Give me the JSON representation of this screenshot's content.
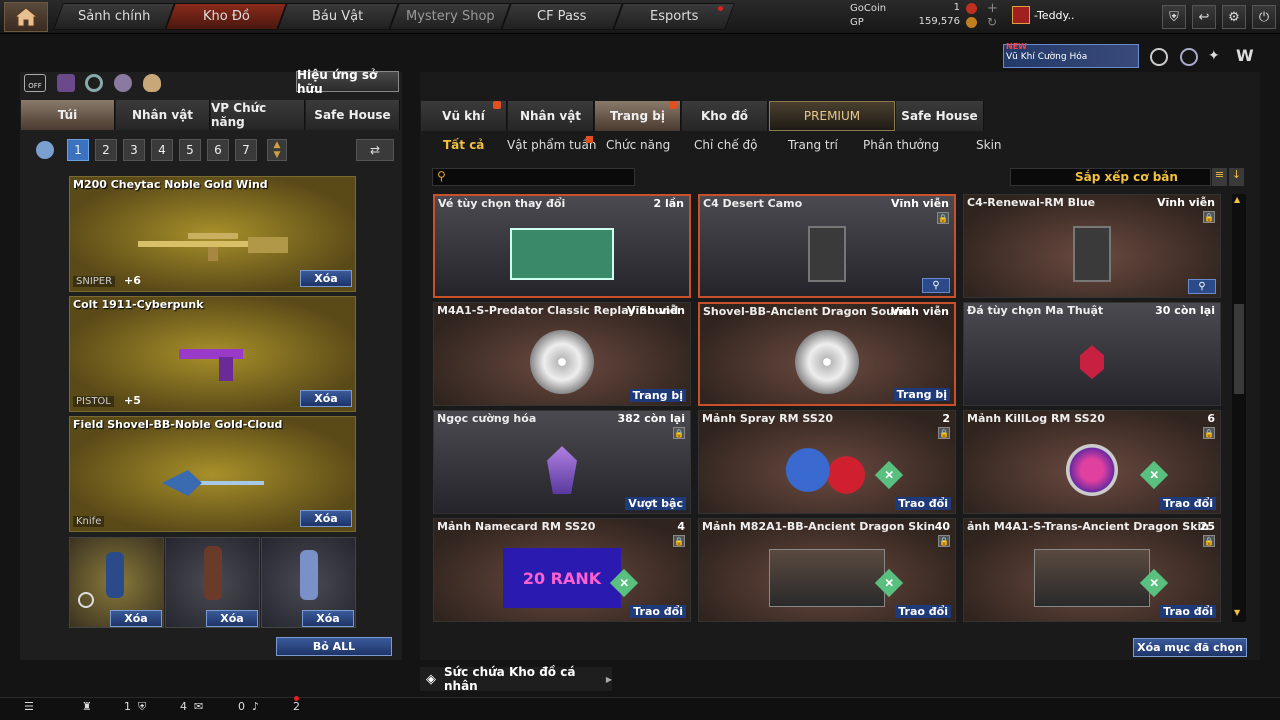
{
  "nav": {
    "tabs": [
      {
        "label": "Sảnh chính"
      },
      {
        "label": "Kho Đồ"
      },
      {
        "label": "Báu Vật"
      },
      {
        "label": "Mystery Shop"
      },
      {
        "label": "CF Pass"
      },
      {
        "label": "Esports"
      }
    ],
    "gocoin_label": "GoCoin",
    "gp_label": "GP",
    "gocoin_value": "1",
    "gp_value": "159,576",
    "username": "-Teddy..",
    "promo_new": "NEW",
    "promo_label": "Vũ Khí Cường Hóa"
  },
  "left": {
    "effects_button": "Hiệu ứng sở hữu",
    "tabs": [
      "Túi",
      "Nhân vật",
      "VP Chức năng",
      "Safe House"
    ],
    "pages": [
      "1",
      "2",
      "3",
      "4",
      "5",
      "6",
      "7"
    ],
    "slots": [
      {
        "name": "M200 Cheytac Noble Gold Wind",
        "type": "SNIPER",
        "plus": "+6",
        "delete": "Xóa"
      },
      {
        "name": "Colt 1911-Cyberpunk",
        "type": "PISTOL",
        "plus": "+5",
        "delete": "Xóa"
      },
      {
        "name": "Field Shovel-BB-Noble Gold-Cloud",
        "type": "Knife",
        "plus": "",
        "delete": "Xóa"
      }
    ],
    "grenades": [
      {
        "delete": "Xóa"
      },
      {
        "delete": "Xóa"
      },
      {
        "delete": "Xóa"
      }
    ],
    "remove_all": "Bỏ ALL"
  },
  "right": {
    "tabs": [
      "Vũ khí",
      "Nhân vật",
      "Trang bị",
      "Kho đồ",
      "PREMIUM",
      "Safe House"
    ],
    "subcats": [
      "Tất cả",
      "Vật phẩm tuần",
      "Chức năng",
      "Chỉ chế độ",
      "Trang trí",
      "Phần thưởng",
      "Skin"
    ],
    "sort_label": "Sắp xếp cơ bản",
    "items": [
      {
        "name": "Vé tùy chọn thay đổi",
        "right": "2 lần",
        "action": ""
      },
      {
        "name": "C4 Desert Camo",
        "right": "Vĩnh viễn",
        "action": ""
      },
      {
        "name": "C4-Renewal-RM Blue",
        "right": "Vĩnh viễn",
        "action": ""
      },
      {
        "name": "M4A1-S-Predator Classic Replay Sound",
        "right": "Vĩnh viễn",
        "action": "Trang bị"
      },
      {
        "name": "Shovel-BB-Ancient Dragon Sound",
        "right": "Vĩnh viễn",
        "action": "Trang bị"
      },
      {
        "name": "Đá tùy chọn Ma Thuật",
        "right": "30 còn lại",
        "action": ""
      },
      {
        "name": "Ngọc cường hóa",
        "right": "382 còn lại",
        "action": "Vượt bậc"
      },
      {
        "name": "Mảnh Spray RM SS20",
        "right": "2",
        "action": "Trao đổi"
      },
      {
        "name": "Mảnh KillLog RM SS20",
        "right": "6",
        "action": "Trao đổi"
      },
      {
        "name": "Mảnh Namecard RM SS20",
        "right": "4",
        "action": "Trao đổi"
      },
      {
        "name": "Mảnh M82A1-BB-Ancient Dragon Skin",
        "right": "40",
        "action": "Trao đổi"
      },
      {
        "name": "ảnh M4A1-S-Trans-Ancient Dragon Skin",
        "right": "25",
        "action": "Trao đổi"
      }
    ],
    "delete_selected": "Xóa mục đã chọn",
    "capacity": "Sức chứa Kho đồ cá nhân",
    "namecard_text": "20 RANK"
  },
  "bottom": {
    "count1": "1",
    "count2": "4",
    "count3": "0",
    "count4": "2"
  }
}
